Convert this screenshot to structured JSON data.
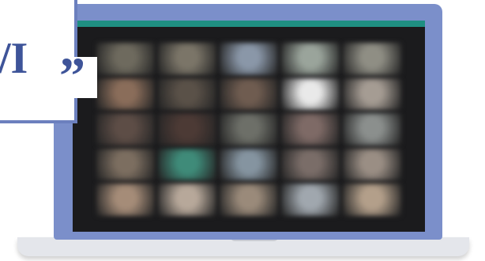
{
  "callout": {
    "text": "””",
    "partial_text": "/I",
    "quote_mark": "”"
  },
  "meeting_grid": {
    "rows": 5,
    "cols": 5,
    "tile_colors": [
      [
        "#6e6a5e",
        "#7b7568",
        "#8a97a8",
        "#9aa49b",
        "#8f8e84"
      ],
      [
        "#8a6d5a",
        "#5a5148",
        "#6f5c50",
        "#e9e9e9",
        "#a59c93"
      ],
      [
        "#5d4d46",
        "#4c3a35",
        "#6d6f68",
        "#7e6a66",
        "#8b8f8d"
      ],
      [
        "#7c6e60",
        "#3f8b79",
        "#8594a0",
        "#7a6d68",
        "#9a8e84"
      ],
      [
        "#a58c78",
        "#b7a89a",
        "#9a8a7a",
        "#a0a7ae",
        "#b39f8a"
      ]
    ]
  },
  "colors": {
    "laptop_body": "#7b8fca",
    "screen_bar": "#1f8f82",
    "callout_border": "#6c80be",
    "quote": "#3e5499"
  }
}
